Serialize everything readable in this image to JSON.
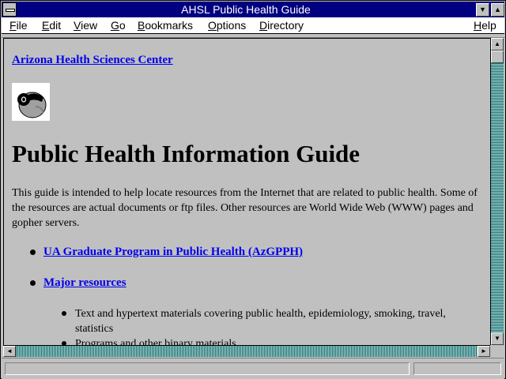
{
  "window": {
    "title": "AHSL Public Health Guide"
  },
  "menubar": {
    "items": [
      {
        "label": "File",
        "key": "F",
        "rest": "ile"
      },
      {
        "label": "Edit",
        "key": "E",
        "rest": "dit"
      },
      {
        "label": "View",
        "key": "V",
        "rest": "iew"
      },
      {
        "label": "Go",
        "key": "G",
        "rest": "o"
      },
      {
        "label": "Bookmarks",
        "key": "B",
        "rest": "ookmarks"
      },
      {
        "label": "Options",
        "key": "O",
        "rest": "ptions"
      },
      {
        "label": "Directory",
        "key": "D",
        "rest": "irectory"
      },
      {
        "label": "Help",
        "key": "H",
        "rest": "elp"
      }
    ]
  },
  "page": {
    "top_link": "Arizona Health Sciences Center",
    "heading": "Public Health Information Guide",
    "intro": "This guide is intended to help locate resources from the Internet that are related to public health. Some of the resources are actual documents or ftp files. Other resources are World Wide Web (WWW) pages and gopher servers.",
    "links": [
      "UA Graduate Program in Public Health (AzGPPH)",
      "Major resources"
    ],
    "sub_items": [
      "Text and hypertext materials covering public health, epidemiology, smoking, travel, statistics",
      "Programs and other binary materials"
    ]
  },
  "status": {
    "message": ""
  },
  "colors": {
    "titlebar": "#000080",
    "link": "#0000ee",
    "background": "#c0c0c0",
    "scroll_track": "#008080"
  }
}
